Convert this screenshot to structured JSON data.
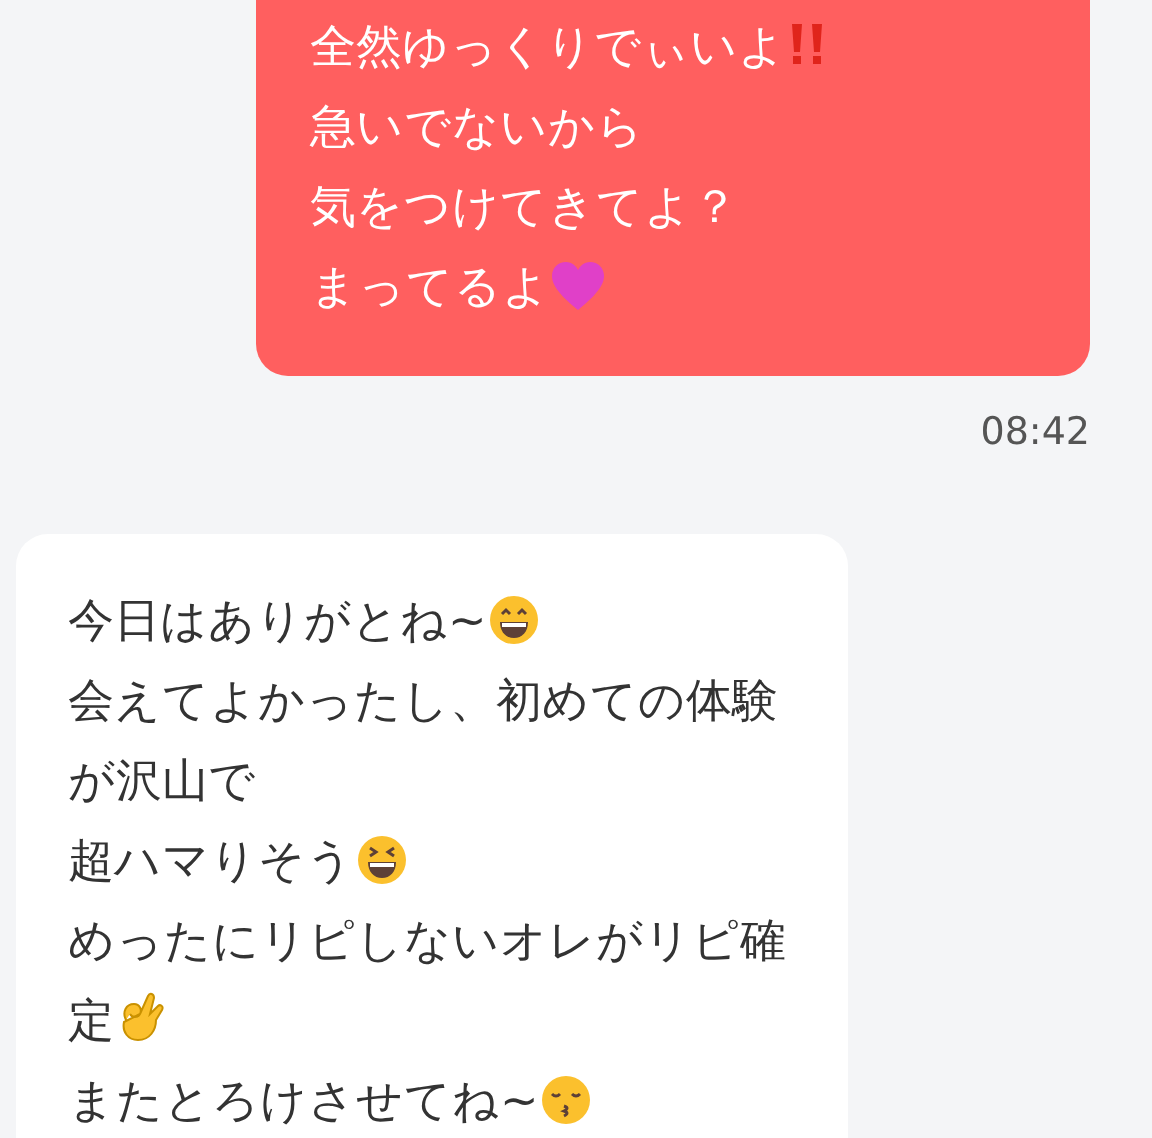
{
  "messages": [
    {
      "kind": "sent",
      "lines": [
        {
          "text": "全然ゆっくりでぃいよ",
          "kind": "double-exclamation"
        },
        {
          "text": "急いでないから",
          "kind": "plain"
        },
        {
          "text": "気をつけてきてよ？",
          "kind": "plain"
        },
        {
          "text": "まってるよ",
          "kind": "heart"
        }
      ],
      "time": "08:42"
    },
    {
      "kind": "received",
      "lines": [
        {
          "text": "今日はありがとね~",
          "kind": "grin"
        },
        {
          "text": "会えてよかったし、初めての体験",
          "kind": "plain"
        },
        {
          "text": "が沢山で",
          "kind": "plain"
        },
        {
          "text": "超ハマりそう",
          "kind": "laugh"
        },
        {
          "text": "めったにリピしないオレがリピ確",
          "kind": "plain"
        },
        {
          "text": "定",
          "kind": "ok-hand"
        },
        {
          "text": "またとろけさせてね~",
          "kind": "kiss"
        }
      ]
    }
  ]
}
